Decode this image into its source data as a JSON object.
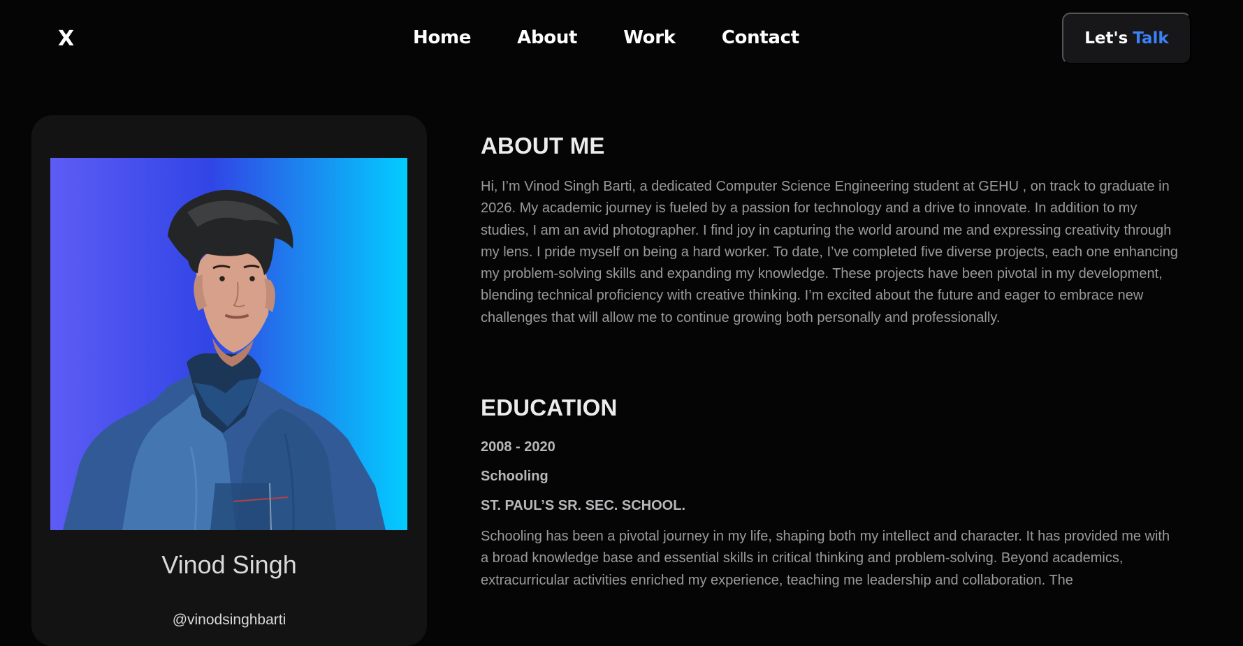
{
  "nav": {
    "logo": "X",
    "links": [
      "Home",
      "About",
      "Work",
      "Contact"
    ],
    "cta": {
      "label": "Let's",
      "accent": "Talk"
    }
  },
  "profile": {
    "name": "Vinod Singh",
    "handle": "@vinodsinghbarti"
  },
  "about": {
    "title": "ABOUT ME",
    "text": "Hi, I’m Vinod Singh Barti, a dedicated Computer Science Engineering student at GEHU , on track to graduate in 2026. My academic journey is fueled by a passion for technology and a drive to innovate. In addition to my studies, I am an avid photographer. I find joy in capturing the world around me and expressing creativity through my lens. I pride myself on being a hard worker. To date, I’ve completed five diverse projects, each one enhancing my problem-solving skills and expanding my knowledge. These projects have been pivotal in my development, blending technical proficiency with creative thinking. I’m excited about the future and eager to embrace new challenges that will allow me to continue growing both personally and professionally."
  },
  "education": {
    "title": "EDUCATION",
    "years": "2008 - 2020",
    "type": "Schooling",
    "school": "ST. PAUL’S SR. SEC. SCHOOL.",
    "text": "Schooling has been a pivotal journey in my life, shaping both my intellect and character. It has provided me with a broad knowledge base and essential skills in critical thinking and problem-solving. Beyond academics, extracurricular activities enriched my experience, teaching me leadership and collaboration. The"
  },
  "colors": {
    "background": "#050506",
    "card": "#131314",
    "accent": "#3b82f6",
    "gradient_start": "#5d5cf5",
    "gradient_end": "#03ccff"
  },
  "icons": {
    "profile_photo": "person-portrait-photo"
  }
}
